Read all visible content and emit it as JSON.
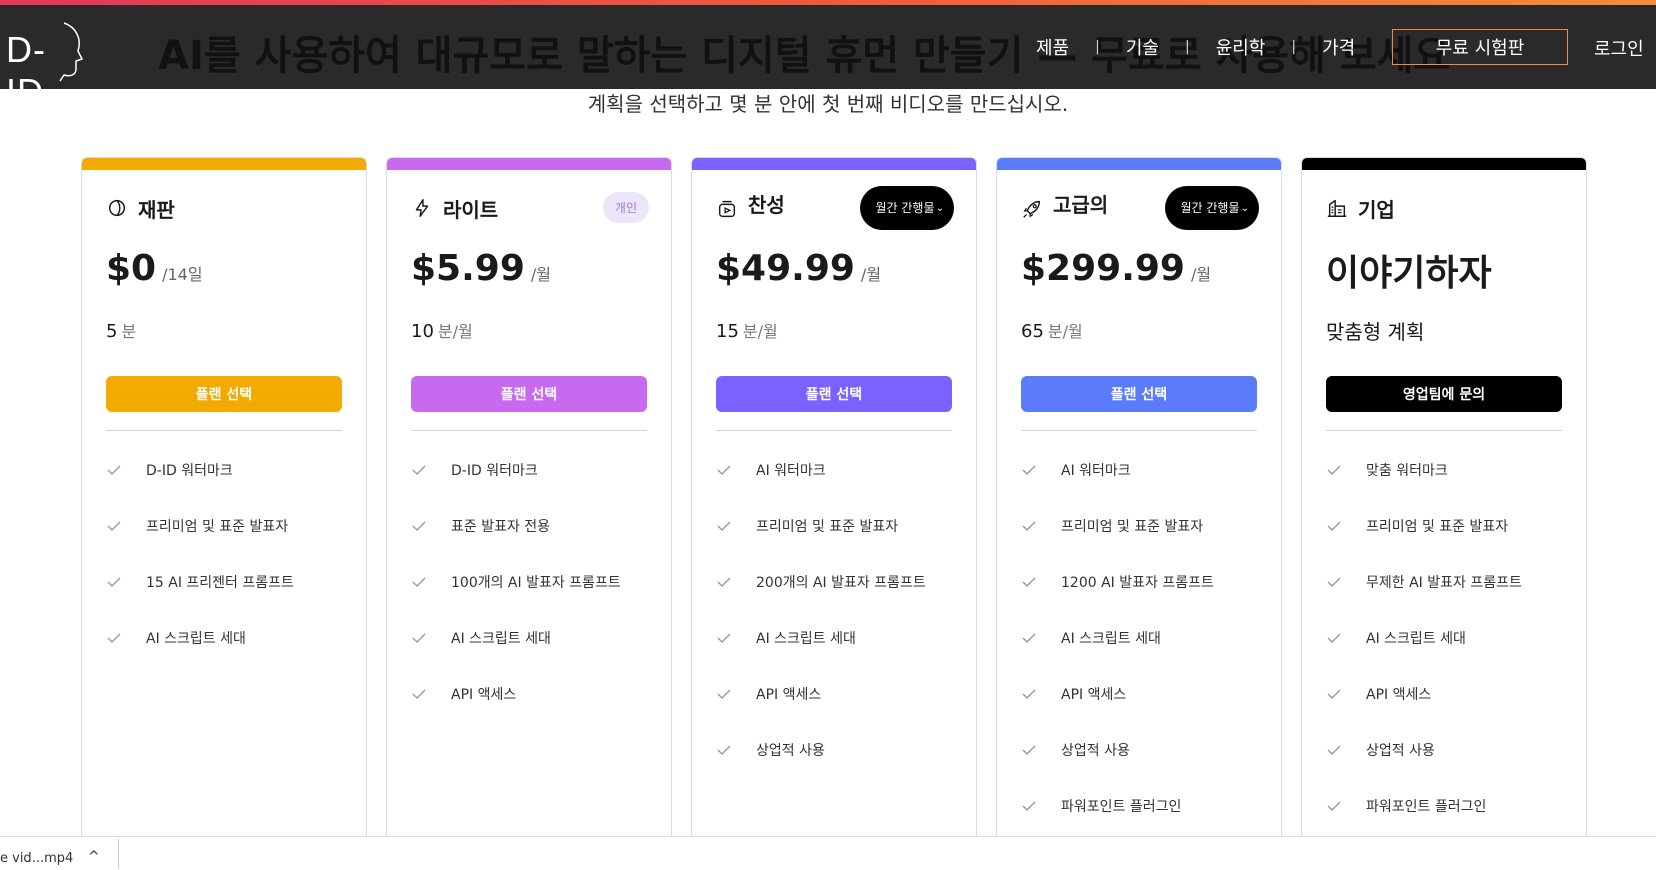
{
  "colors": {
    "nav_bg": "#2a2a2a",
    "accent_gradient": [
      "#e0395a",
      "#f48c3a"
    ],
    "trial_border": "#f1894b"
  },
  "hero": {
    "headline": "AI를 사용하여 대규모로 말하는 디지털 휴먼 만들기 — 무료로 사용해 보세요",
    "subtitle": "계획을 선택하고 몇 분 안에 첫 번째 비디오를 만드십시오."
  },
  "nav": {
    "logo": "D-ID",
    "links": [
      "제품",
      "기술",
      "윤리학",
      "가격"
    ],
    "separator": "|",
    "trial_button": "무료 시험판",
    "login": "로그인"
  },
  "plans": [
    {
      "name": "재판",
      "icon": "leaf-icon",
      "color": "#f2a900",
      "price": "$0",
      "period": "/14일",
      "minutes": "5",
      "minutes_unit": "분",
      "cta": "플랜 선택",
      "features": [
        "D-ID 워터마크",
        "프리미엄 및 표준 발표자",
        "15 AI 프리젠터 프롬프트",
        "AI 스크립트 세대"
      ]
    },
    {
      "name": "라이트",
      "icon": "lightning-icon",
      "color": "#c86af0",
      "badge": "개인",
      "price": "$5.99",
      "period": "/월",
      "minutes": "10",
      "minutes_unit": "분/월",
      "cta": "플랜 선택",
      "features": [
        "D-ID 워터마크",
        "표준 발표자 전용",
        "100개의 AI 발표자 프롬프트",
        "AI 스크립트 세대",
        "API 액세스"
      ]
    },
    {
      "name": "찬성",
      "icon": "video-jar-icon",
      "color": "#7b61ff",
      "interval": "월간 간행물",
      "price": "$49.99",
      "period": "/월",
      "minutes": "15",
      "minutes_unit": "분/월",
      "cta": "플랜 선택",
      "features": [
        "AI 워터마크",
        "프리미엄 및 표준 발표자",
        "200개의 AI 발표자 프롬프트",
        "AI 스크립트 세대",
        "API 액세스",
        "상업적 사용"
      ]
    },
    {
      "name": "고급의",
      "icon": "rocket-icon",
      "color": "#5b7cfa",
      "interval": "월간 간행물",
      "price": "$299.99",
      "period": "/월",
      "minutes": "65",
      "minutes_unit": "분/월",
      "cta": "플랜 선택",
      "features": [
        "AI 워터마크",
        "프리미엄 및 표준 발표자",
        "1200 AI 발표자 프롬프트",
        "AI 스크립트 세대",
        "API 액세스",
        "상업적 사용",
        "파워포인트 플러그인"
      ]
    },
    {
      "name": "기업",
      "icon": "building-icon",
      "color": "#000000",
      "talk": "이야기하자",
      "custom": "맞춤형 계획",
      "cta": "영업팀에 문의",
      "features": [
        "맞춤 워터마크",
        "프리미엄 및 표준 발표자",
        "무제한 AI 발표자 프롬프트",
        "AI 스크립트 세대",
        "API 액세스",
        "상업적 사용",
        "파워포인트 플러그인"
      ]
    }
  ],
  "download_bar": {
    "file": "e vid...mp4",
    "chevron": "^"
  }
}
